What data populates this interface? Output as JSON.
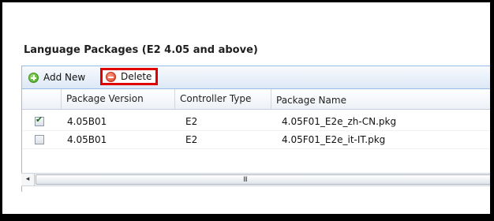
{
  "section": {
    "title": "Language Packages (E2 4.05 and above)"
  },
  "toolbar": {
    "add_label": "Add New",
    "delete_label": "Delete",
    "add_icon": "add-circle-icon",
    "delete_icon": "remove-circle-icon",
    "highlight_color": "#e00000"
  },
  "grid": {
    "columns": [
      "Package Version",
      "Controller Type",
      "Package Name"
    ],
    "rows": [
      {
        "checked": true,
        "version": "4.05B01",
        "controller": "E2",
        "name": "4.05F01_E2e_zh-CN.pkg"
      },
      {
        "checked": false,
        "version": "4.05B01",
        "controller": "E2",
        "name": "4.05F01_E2e_it-IT.pkg"
      }
    ]
  },
  "scrollbar": {
    "left_arrow": "◂",
    "grip": "III"
  }
}
